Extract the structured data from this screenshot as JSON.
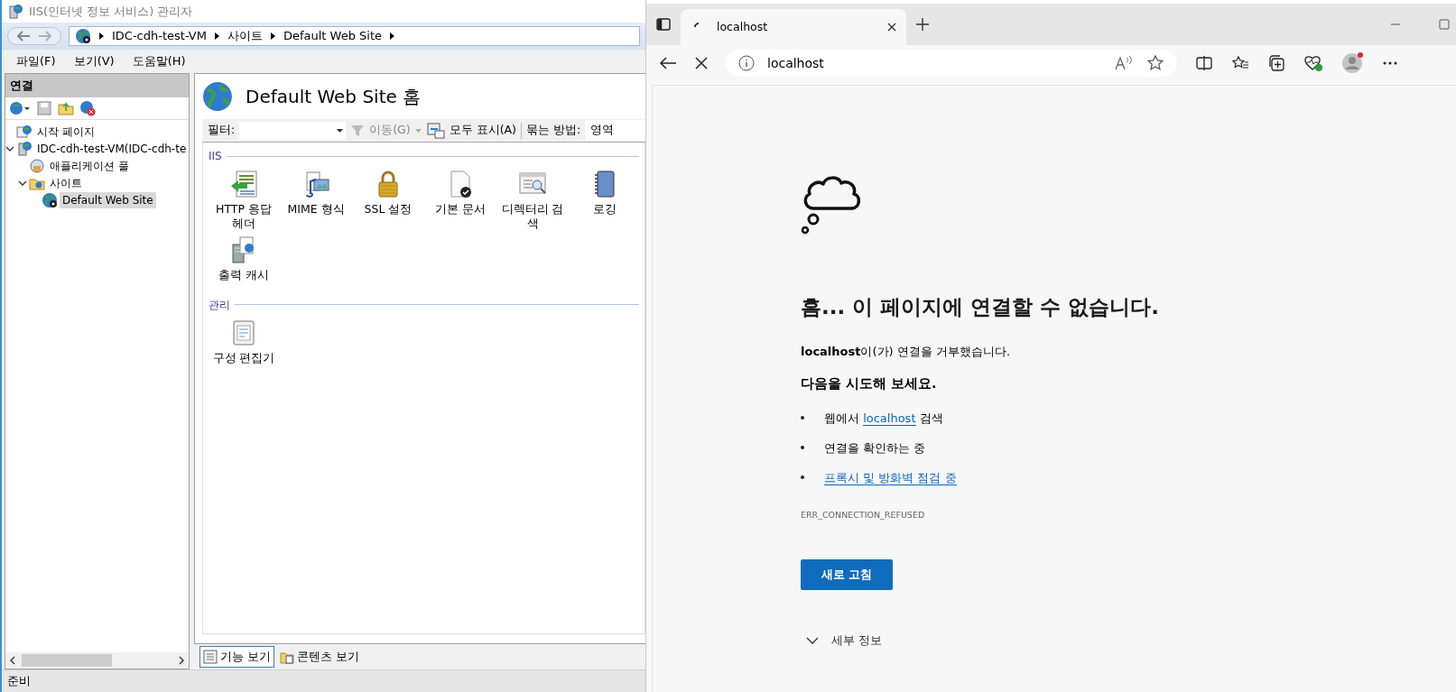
{
  "iis": {
    "title": "IIS(인터넷 정보 서비스) 관리자",
    "breadcrumb": [
      "IDC-cdh-test-VM",
      "사이트",
      "Default Web Site"
    ],
    "menu": [
      "파일(F)",
      "보기(V)",
      "도움말(H)"
    ],
    "connections_title": "연결",
    "tree": [
      {
        "label": "시작 페이지",
        "kind": "start",
        "selected": false
      },
      {
        "label": "IDC-cdh-test-VM(IDC-cdh-te",
        "kind": "server",
        "selected": false,
        "expanded": true,
        "children": [
          {
            "label": "애플리케이션 풀",
            "kind": "pool",
            "selected": false
          },
          {
            "label": "사이트",
            "kind": "folder",
            "selected": false,
            "expanded": true,
            "children": [
              {
                "label": "Default Web Site",
                "kind": "site",
                "selected": true
              }
            ]
          }
        ]
      }
    ],
    "page_title": "Default Web Site 홈",
    "filter": {
      "label": "필터:",
      "go": "이동(G)",
      "show_all": "모두 표시(A)",
      "group_label": "묶는 방법:",
      "group_value": "영역"
    },
    "groups": [
      {
        "title": "IIS",
        "features": [
          {
            "label": "HTTP 응답 헤더",
            "kind": "http"
          },
          {
            "label": "MIME 형식",
            "kind": "mime"
          },
          {
            "label": "SSL 설정",
            "kind": "ssl"
          },
          {
            "label": "기본 문서",
            "kind": "doc"
          },
          {
            "label": "디렉터리 검색",
            "kind": "dir"
          },
          {
            "label": "로깅",
            "kind": "log"
          },
          {
            "label": "출력 캐시",
            "kind": "cache"
          }
        ]
      },
      {
        "title": "관리",
        "features": [
          {
            "label": "구성 편집기",
            "kind": "config"
          }
        ]
      }
    ],
    "view_tabs": [
      {
        "label": "기능 보기",
        "selected": true
      },
      {
        "label": "콘텐츠 보기",
        "selected": false
      }
    ],
    "status": "준비"
  },
  "browser": {
    "tab_title": "localhost",
    "address": "localhost",
    "heading": "흠... 이 페이지에 연결할 수 없습니다.",
    "message": "**localhost**이(가) 연결을 거부했습니다.",
    "suggest_title": "다음을 시도해 보세요.",
    "suggestions": [
      {
        "parts": [
          {
            "text": "웹에서 ",
            "link": false
          },
          {
            "text": "localhost",
            "link": true
          },
          {
            "text": " 검색",
            "link": false
          }
        ]
      },
      {
        "parts": [
          {
            "text": "연결을 확인하는 중",
            "link": false
          }
        ]
      },
      {
        "parts": [
          {
            "text": "프록시 및 방화벽 점검 중",
            "link": true
          }
        ]
      }
    ],
    "error_code": "ERR_CONNECTION_REFUSED",
    "reload": "새로 고침",
    "details": "세부 정보"
  }
}
